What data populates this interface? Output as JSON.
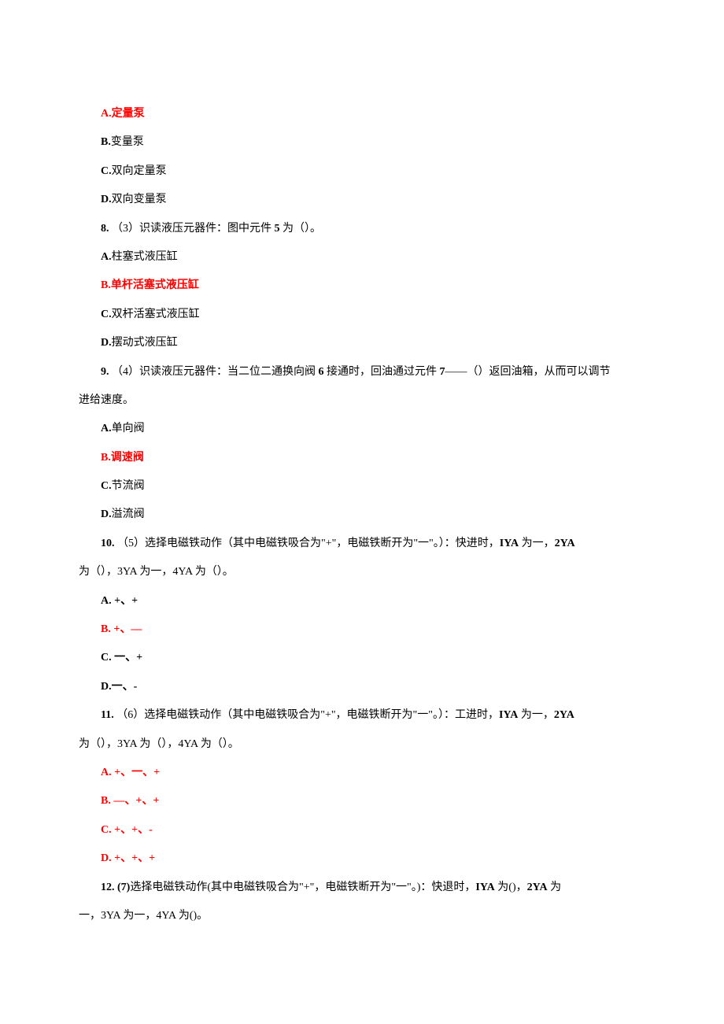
{
  "items": [
    {
      "type": "option",
      "label": "A.",
      "text": "定量泵",
      "red": true,
      "bold": true
    },
    {
      "type": "option",
      "label": "B.",
      "text": "变量泵",
      "red": false,
      "bold": false
    },
    {
      "type": "option",
      "label": "C.",
      "text": "双向定量泵",
      "red": false,
      "bold": false
    },
    {
      "type": "option",
      "label": "D.",
      "text": "双向变量泵",
      "red": false,
      "bold": false
    },
    {
      "type": "question",
      "num": "8. ",
      "segs": [
        {
          "t": "（3）识读液压元器件：图中元件 ",
          "b": false
        },
        {
          "t": "5",
          "b": true
        },
        {
          "t": " 为（）。",
          "b": false
        }
      ]
    },
    {
      "type": "option",
      "label": "A.",
      "text": "柱塞式液压缸",
      "red": false,
      "bold": false
    },
    {
      "type": "option",
      "label": "B.",
      "text": "单杆活塞式液压缸",
      "red": true,
      "bold": true
    },
    {
      "type": "option",
      "label": "C.",
      "text": "双杆活塞式液压缸",
      "red": false,
      "bold": false
    },
    {
      "type": "option",
      "label": "D.",
      "text": "摆动式液压缸",
      "red": false,
      "bold": false
    },
    {
      "type": "question",
      "num": "9. ",
      "segs": [
        {
          "t": "（4）识读液压元器件：当二位二通换向阀 ",
          "b": false
        },
        {
          "t": "6",
          "b": true
        },
        {
          "t": " 接通时，回油通过元件 ",
          "b": false
        },
        {
          "t": "7",
          "b": true
        },
        {
          "t": "——（）返回油箱，从而可以调节",
          "b": false
        }
      ],
      "cont": "进给速度。"
    },
    {
      "type": "option",
      "label": "A.",
      "text": "单向阀",
      "red": false,
      "bold": false
    },
    {
      "type": "option",
      "label": "B.",
      "text": "调速阀",
      "red": true,
      "bold": true
    },
    {
      "type": "option",
      "label": "C.",
      "text": "节流阀",
      "red": false,
      "bold": false
    },
    {
      "type": "option",
      "label": "D.",
      "text": "溢流阀",
      "red": false,
      "bold": false
    },
    {
      "type": "question",
      "num": "10. ",
      "segs": [
        {
          "t": "（5）选择电磁铁动作（其中电磁铁吸合为\"+\"，电磁铁断开为\"一\"。）：快进时，",
          "b": false
        },
        {
          "t": "IYA",
          "b": true
        },
        {
          "t": " 为一，",
          "b": false
        },
        {
          "t": "2YA",
          "b": true
        }
      ],
      "contSegs": [
        {
          "t": "为（），",
          "b": false
        },
        {
          "t": "3YA",
          "b": true
        },
        {
          "t": " 为一，",
          "b": false
        },
        {
          "t": "4YA",
          "b": true
        },
        {
          "t": " 为（）。",
          "b": false
        }
      ]
    },
    {
      "type": "option",
      "label": "A.",
      "text": "  +、+",
      "red": false,
      "bold": true
    },
    {
      "type": "option",
      "label": "B.",
      "text": "  +、—",
      "red": true,
      "bold": true
    },
    {
      "type": "option",
      "label": "C.",
      "text": "  一、+",
      "red": false,
      "bold": true
    },
    {
      "type": "option",
      "label": "D.",
      "text": "一、-",
      "red": false,
      "bold": true
    },
    {
      "type": "question",
      "num": "11. ",
      "segs": [
        {
          "t": "（6）选择电磁铁动作（其中电磁铁吸合为\"+\"，电磁铁断开为\"一\"。）：工进时，",
          "b": false
        },
        {
          "t": "IYA",
          "b": true
        },
        {
          "t": " 为一，",
          "b": false
        },
        {
          "t": "2YA",
          "b": true
        }
      ],
      "contSegs": [
        {
          "t": "为（），",
          "b": false
        },
        {
          "t": "3YA",
          "b": true
        },
        {
          "t": " 为（），",
          "b": false
        },
        {
          "t": "4YA",
          "b": true
        },
        {
          "t": " 为（）。",
          "b": false
        }
      ]
    },
    {
      "type": "option",
      "label": "A.",
      "text": "  +、一、+",
      "red": true,
      "bold": true
    },
    {
      "type": "option",
      "label": "B.",
      "text": "  —、+、+",
      "red": true,
      "bold": true
    },
    {
      "type": "option",
      "label": "C.",
      "text": "  +、+、-",
      "red": true,
      "bold": true
    },
    {
      "type": "option",
      "label": "D.",
      "text": "  +、+、+",
      "red": true,
      "bold": true
    },
    {
      "type": "question",
      "num": "12. ",
      "segs": [
        {
          "t": "(7)",
          "b": true
        },
        {
          "t": "选择电磁铁动作(其中电磁铁吸合为\"+\"，电磁铁断开为\"一\"。)：快退时，",
          "b": false
        },
        {
          "t": "IYA",
          "b": true
        },
        {
          "t": " 为()，",
          "b": false
        },
        {
          "t": "2YA",
          "b": true
        },
        {
          "t": " 为",
          "b": false
        }
      ],
      "contSegs": [
        {
          "t": "一，",
          "b": false
        },
        {
          "t": "3YA",
          "b": true
        },
        {
          "t": " 为一，",
          "b": false
        },
        {
          "t": "4YA",
          "b": true
        },
        {
          "t": " 为()。",
          "b": false
        }
      ]
    }
  ]
}
